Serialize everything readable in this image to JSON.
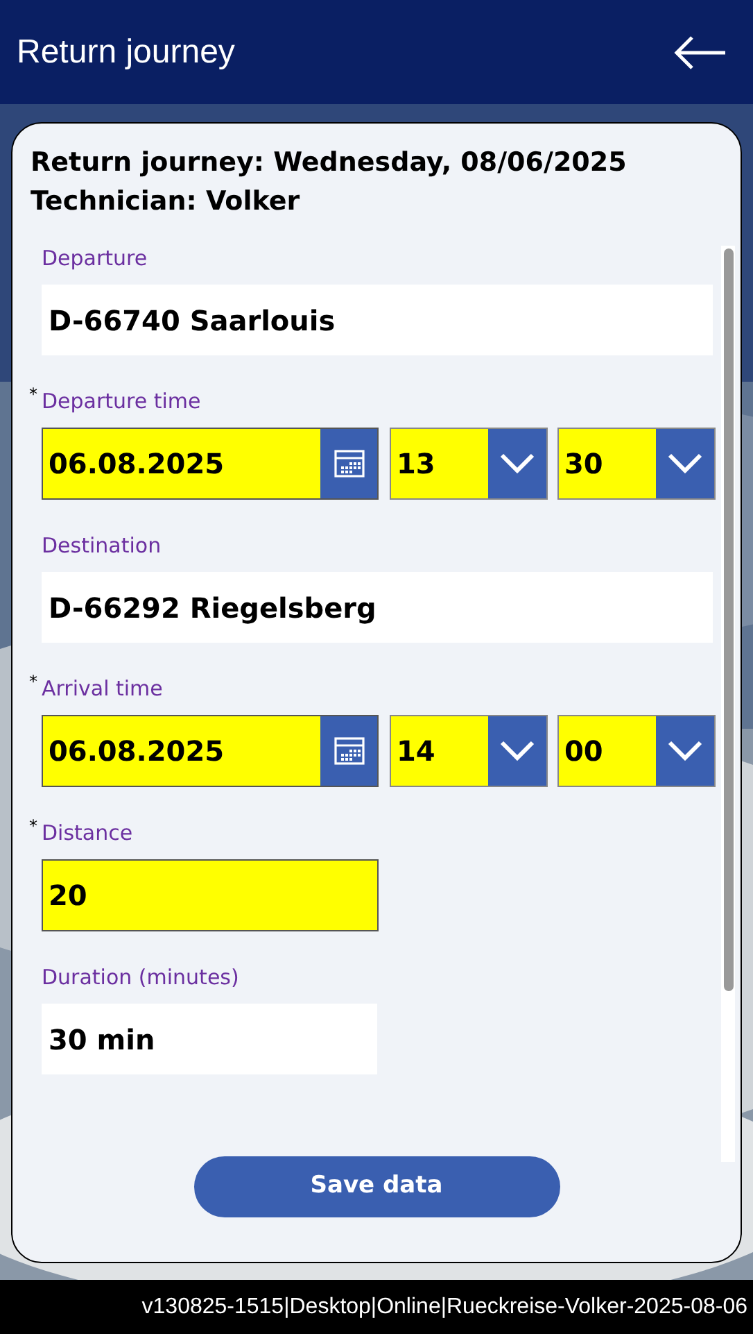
{
  "header": {
    "title": "Return journey"
  },
  "card": {
    "heading_lines": [
      "Return journey: Wednesday, 08/06/2025",
      "Technician: Volker"
    ]
  },
  "fields": [
    {
      "kind": "text",
      "label": "Departure",
      "required": false,
      "value": "D-66740 Saarlouis"
    },
    {
      "kind": "datetime",
      "label": "Departure time",
      "required": true,
      "date": "06.08.2025",
      "hour": "13",
      "minute": "30"
    },
    {
      "kind": "text",
      "label": "Destination",
      "required": false,
      "value": "D-66292 Riegelsberg"
    },
    {
      "kind": "datetime",
      "label": "Arrival time",
      "required": true,
      "date": "06.08.2025",
      "hour": "14",
      "minute": "00"
    },
    {
      "kind": "number",
      "label": "Distance",
      "required": true,
      "value": "20"
    },
    {
      "kind": "readonly",
      "label": "Duration (minutes)",
      "required": false,
      "value": "30 min"
    }
  ],
  "required_mark": "*",
  "save_button": "Save data",
  "status_bar": {
    "text": "v130825-1515|Desktop|Online|Rueckreise-Volker-2025-08-06"
  }
}
